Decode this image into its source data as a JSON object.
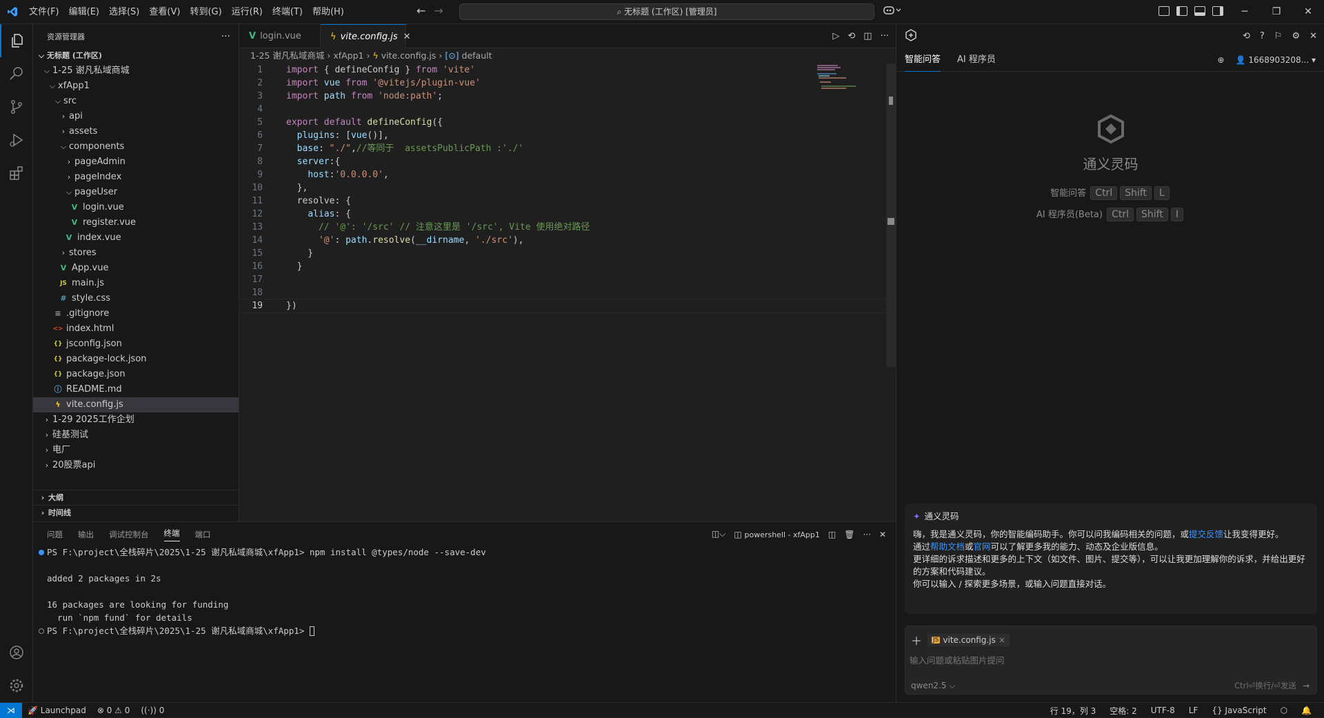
{
  "titlebar": {
    "menus": [
      "文件(F)",
      "编辑(E)",
      "选择(S)",
      "查看(V)",
      "转到(G)",
      "运行(R)",
      "终端(T)",
      "帮助(H)"
    ],
    "search_text": "无标题 (工作区) [管理员]"
  },
  "sidebar": {
    "title": "资源管理器",
    "workspace": "无标题 (工作区)",
    "items": [
      {
        "label": "1-25 谢凡私域商城",
        "indent": 1,
        "chev": "open"
      },
      {
        "label": "xfApp1",
        "indent": 2,
        "chev": "open"
      },
      {
        "label": "src",
        "indent": 3,
        "chev": "open"
      },
      {
        "label": "api",
        "indent": 4,
        "chev": "closed"
      },
      {
        "label": "assets",
        "indent": 4,
        "chev": "closed"
      },
      {
        "label": "components",
        "indent": 4,
        "chev": "open"
      },
      {
        "label": "pageAdmin",
        "indent": 5,
        "chev": "closed"
      },
      {
        "label": "pageIndex",
        "indent": 5,
        "chev": "closed"
      },
      {
        "label": "pageUser",
        "indent": 5,
        "chev": "open"
      },
      {
        "label": "login.vue",
        "indent": 6,
        "icon": "vue"
      },
      {
        "label": "register.vue",
        "indent": 6,
        "icon": "vue"
      },
      {
        "label": "index.vue",
        "indent": 5,
        "icon": "vue"
      },
      {
        "label": "stores",
        "indent": 4,
        "chev": "closed"
      },
      {
        "label": "App.vue",
        "indent": 4,
        "icon": "vue"
      },
      {
        "label": "main.js",
        "indent": 4,
        "icon": "js"
      },
      {
        "label": "style.css",
        "indent": 4,
        "icon": "css"
      },
      {
        "label": ".gitignore",
        "indent": 3,
        "icon": "git"
      },
      {
        "label": "index.html",
        "indent": 3,
        "icon": "html"
      },
      {
        "label": "jsconfig.json",
        "indent": 3,
        "icon": "json"
      },
      {
        "label": "package-lock.json",
        "indent": 3,
        "icon": "json"
      },
      {
        "label": "package.json",
        "indent": 3,
        "icon": "json"
      },
      {
        "label": "README.md",
        "indent": 3,
        "icon": "md"
      },
      {
        "label": "vite.config.js",
        "indent": 3,
        "icon": "vite",
        "selected": true
      },
      {
        "label": "1-29 2025工作企划",
        "indent": 1,
        "chev": "closed"
      },
      {
        "label": "硅基测试",
        "indent": 1,
        "chev": "closed"
      },
      {
        "label": "电厂",
        "indent": 1,
        "chev": "closed"
      },
      {
        "label": "20股票api",
        "indent": 1,
        "chev": "closed"
      }
    ],
    "outline": "大纲",
    "timeline": "时间线"
  },
  "editor": {
    "tabs": [
      {
        "label": "login.vue",
        "active": false
      },
      {
        "label": "vite.config.js",
        "active": true
      }
    ],
    "breadcrumb": [
      "1-25 谢凡私域商城",
      "xfApp1",
      "vite.config.js",
      "default"
    ],
    "lines": [
      "import { defineConfig } from 'vite'",
      "import vue from '@vitejs/plugin-vue'",
      "import path from 'node:path';",
      "",
      "export default defineConfig({",
      "  plugins: [vue()],",
      "  base: \"./\",//等同于  assetsPublicPath :'./'",
      "  server:{",
      "    host:'0.0.0.0',",
      "  },",
      "  resolve: {",
      "    alias: {",
      "      // '@': '/src' // 注意这里是 '/src', Vite 使用绝对路径",
      "      '@': path.resolve(__dirname, './src'),",
      "    }",
      "  }",
      "",
      "",
      "})"
    ],
    "current_line": 19
  },
  "panel": {
    "tabs": [
      "问题",
      "输出",
      "调试控制台",
      "终端",
      "端口"
    ],
    "active_tab": "终端",
    "terminal_name": "powershell - xfApp1",
    "terminal_lines": [
      {
        "text": "PS F:\\project\\全栈碎片\\2025\\1-25 谢凡私域商城\\xfApp1> npm install @types/node --save-dev",
        "dot": "blue"
      },
      {
        "text": ""
      },
      {
        "text": "added 2 packages in 2s"
      },
      {
        "text": ""
      },
      {
        "text": "16 packages are looking for funding"
      },
      {
        "text": "  run `npm fund` for details"
      },
      {
        "text": "PS F:\\project\\全栈碎片\\2025\\1-25 谢凡私域商城\\xfApp1> ",
        "dot": "gray"
      }
    ]
  },
  "ai": {
    "tabs": [
      "智能问答",
      "AI 程序员"
    ],
    "user": "1668903208...",
    "brand": "通义灵码",
    "hints": [
      {
        "label": "智能问答",
        "keys": [
          "Ctrl",
          "Shift",
          "L"
        ]
      },
      {
        "label": "AI 程序员(Beta)",
        "keys": [
          "Ctrl",
          "Shift",
          "I"
        ]
      }
    ],
    "msg_title": "通义灵码",
    "msg_p1a": "嗨，我是通义灵码，你的智能编码助手。你可以问我编码相关的问题，或",
    "msg_p1link": "提交反馈",
    "msg_p1b": "让我变得更好。",
    "msg_p2a": "通过",
    "msg_p2link1": "帮助文档",
    "msg_p2b": "或",
    "msg_p2link2": "官网",
    "msg_p2c": "可以了解更多我的能力、动态及企业版信息。",
    "msg_p3": "更详细的诉求描述和更多的上下文（如文件、图片、提交等），可以让我更加理解你的诉求，并给出更好的方案和代码建议。",
    "msg_p4": "你可以输入 / 探索更多场景，或输入问题直接对话。",
    "context_chip": "vite.config.js",
    "input_placeholder": "输入问题或粘贴图片提问",
    "model": "qwen2.5",
    "send_hint": "Ctrl⏎换行/⏎发送"
  },
  "statusbar": {
    "launchpad": "Launchpad",
    "errors": "0",
    "warnings": "0",
    "ports": "0",
    "position": "行 19，列 3",
    "spaces": "空格: 2",
    "encoding": "UTF-8",
    "eol": "LF",
    "language": "JavaScript"
  }
}
